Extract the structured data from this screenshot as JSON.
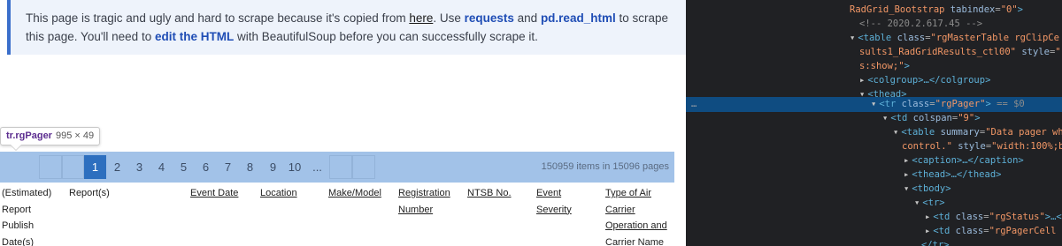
{
  "callout": {
    "t1": "This page is tragic and ugly and hard to scrape because it's copied from ",
    "link": "here",
    "t2": ". Use ",
    "b1": "requests",
    "t3": " and ",
    "b2": "pd.read_html",
    "t4": " to scrape this page. You'll need to ",
    "b3": "edit the HTML",
    "t5": " with BeautifulSoup before you can successfully scrape it."
  },
  "tooltip": {
    "selector": "tr.rgPager",
    "dimensions": "995 × 49"
  },
  "pager": {
    "pages": [
      "1",
      "2",
      "3",
      "4",
      "5",
      "6",
      "7",
      "8",
      "9",
      "10",
      "..."
    ],
    "current_page": "1",
    "info": "150959 items in 15096 pages"
  },
  "columns": [
    {
      "label": "(Estimated) Report Publish Date(s)",
      "sortable": false
    },
    {
      "label": "Report(s)",
      "sortable": false
    },
    {
      "label": "Event Date",
      "sortable": true
    },
    {
      "label": "Location",
      "sortable": true
    },
    {
      "label": "Make/Model",
      "sortable": true
    },
    {
      "label": "Registration Number",
      "sortable": true
    },
    {
      "label": "NTSB No.",
      "sortable": true
    },
    {
      "label": "Event Severity",
      "sortable": true
    },
    {
      "label": "Type of Air Carrier Operation and Carrier Name",
      "sortable": true
    }
  ],
  "devtools": {
    "l0_attr": "RadGrid_Bootstrap",
    "l0_an": "tabindex",
    "l0_av": "\"0\"",
    "l1_comment": "<!-- 2020.2.617.45 -->",
    "l2_tag": "<table",
    "l2_an1": "class",
    "l2_av1": "\"rgMasterTable rgClipCe",
    "l3_av": "sults1_RadGridResults_ctl00\"",
    "l3_an": "style",
    "l3_av2": "\"",
    "l4_av": "s:show;\"",
    "l4_gt": ">",
    "l5": "<colgroup>…</colgroup>",
    "l6": "<thead>",
    "l7_gutter": "…",
    "l7_tag": "<tr",
    "l7_an": "class",
    "l7_av": "\"rgPager\"",
    "l7_ref": "== $0",
    "l8_tag": "<td",
    "l8_an": "colspan",
    "l8_av": "\"9\"",
    "l9_tag": "<table",
    "l9_an": "summary",
    "l9_av": "\"Data pager wh",
    "l10_av": "control.\"",
    "l10_an": "style",
    "l10_av2": "\"width:100%;b",
    "l11": "<caption>…</caption>",
    "l12": "<thead>…</thead>",
    "l13": "<tbody>",
    "l14": "<tr>",
    "l15_tag": "<td",
    "l15_an": "class",
    "l15_av": "\"rgStatus\"",
    "l15_rest": ">…</",
    "l16_tag": "<td",
    "l16_an": "class",
    "l16_av": "\"rgPagerCell N",
    "l17": "</tr>"
  },
  "colors": {
    "callout_bg": "#eef3fb",
    "callout_border": "#3b6fcb",
    "pager_bg": "#a2c2e8",
    "pager_current": "#2d6fbf",
    "devtools_bg": "#202124",
    "devtools_selected": "#0f4c81"
  }
}
